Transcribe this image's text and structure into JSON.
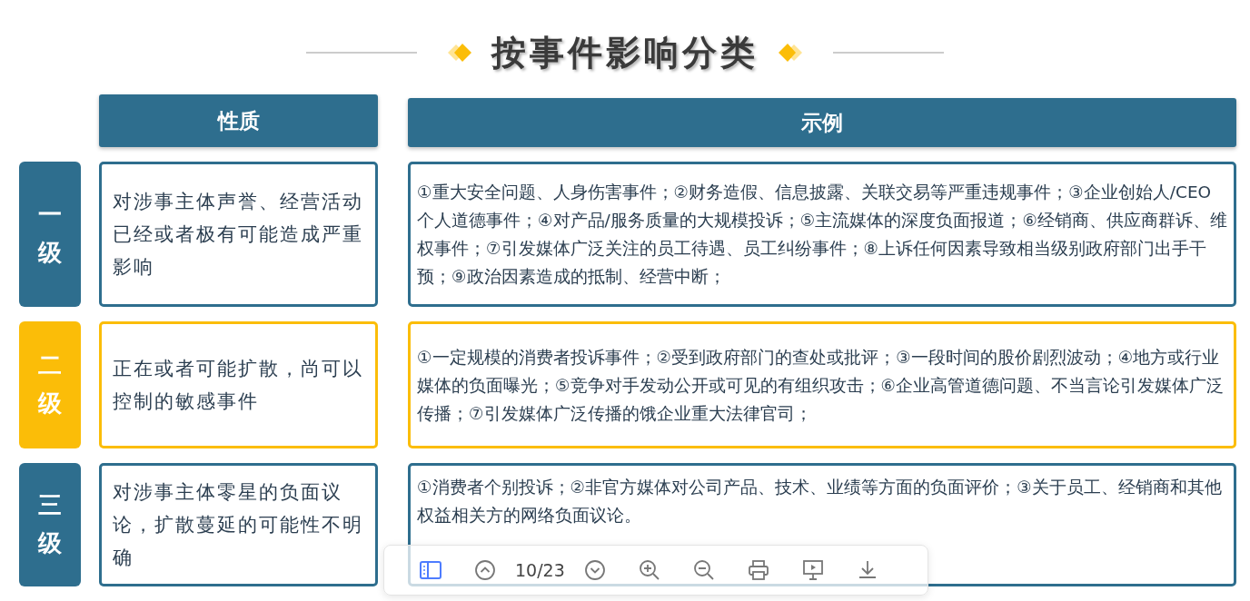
{
  "title": "按事件影响分类",
  "headers": [
    "性质",
    "示例"
  ],
  "levels": [
    {
      "label": "一级",
      "color": "#2e6e8e",
      "nature": "对涉事主体声誉、经营活动已经或者极有可能造成严重影响",
      "examples": "①重大安全问题、人身伤害事件；②财务造假、信息披露、关联交易等严重违规事件；③企业创始人/CEO个人道德事件；④对产品/服务质量的大规模投诉；⑤主流媒体的深度负面报道；⑥经销商、供应商群诉、维权事件；⑦引发媒体广泛关注的员工待遇、员工纠纷事件；⑧上诉任何因素导致相当级别政府部门出手干预；⑨政治因素造成的抵制、经营中断；"
    },
    {
      "label": "二级",
      "color": "#fbbd08",
      "nature": "正在或者可能扩散，尚可以控制的敏感事件",
      "examples": "①一定规模的消费者投诉事件；②受到政府部门的查处或批评；③一段时间的股价剧烈波动；④地方或行业媒体的负面曝光；⑤竞争对手发动公开或可见的有组织攻击；⑥企业高管道德问题、不当言论引发媒体广泛传播；⑦引发媒体广泛传播的饿企业重大法律官司；"
    },
    {
      "label": "三级",
      "color": "#2e6e8e",
      "nature": "对涉事主体零星的负面议论，扩散蔓延的可能性不明确",
      "examples": "①消费者个别投诉；②非官方媒体对公司产品、技术、业绩等方面的负面评价；③关于员工、经销商和其他权益相关方的网络负面议论。"
    }
  ],
  "toolbar": {
    "page": "10/23"
  }
}
